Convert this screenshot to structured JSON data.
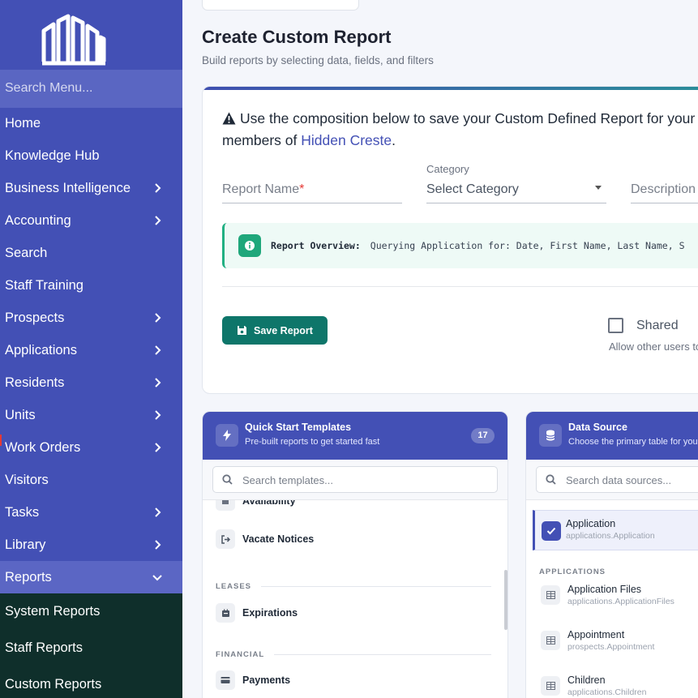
{
  "sidebar": {
    "search_placeholder": "Search Menu...",
    "items": [
      {
        "label": "Home",
        "chevron": false
      },
      {
        "label": "Knowledge Hub",
        "chevron": false
      },
      {
        "label": "Business Intelligence",
        "chevron": true
      },
      {
        "label": "Accounting",
        "chevron": true
      },
      {
        "label": "Search",
        "chevron": false
      },
      {
        "label": "Staff Training",
        "chevron": false
      },
      {
        "label": "Prospects",
        "chevron": true
      },
      {
        "label": "Applications",
        "chevron": true
      },
      {
        "label": "Residents",
        "chevron": true
      },
      {
        "label": "Units",
        "chevron": true
      },
      {
        "label": "Work Orders",
        "chevron": true
      },
      {
        "label": "Visitors",
        "chevron": false
      },
      {
        "label": "Tasks",
        "chevron": true
      },
      {
        "label": "Library",
        "chevron": true
      },
      {
        "label": "Reports",
        "chevron": true,
        "expanded": true
      }
    ],
    "sub_items": [
      "System Reports",
      "Staff Reports",
      "Custom Reports"
    ]
  },
  "header": {
    "title": "Create Custom Report",
    "subtitle": "Build reports by selecting data, fields, and filters"
  },
  "form": {
    "notice_text": "Use the composition below to save your Custom Defined Report for your",
    "notice_text2": "members of",
    "community": "Hidden Creste",
    "notice_end": ".",
    "report_name_label": "Report Name",
    "required_mark": "*",
    "category_label": "Category",
    "category_value": "Select Category",
    "description_label": "Description",
    "overview_label": "Report Overview:",
    "overview_text": "Querying Application for: Date, First Name, Last Name, S",
    "save_label": "Save Report",
    "shared_label": "Shared",
    "shared_help": "Allow other users to"
  },
  "templates": {
    "title": "Quick Start Templates",
    "subtitle": "Pre-built reports to get started fast",
    "count": "17",
    "search_placeholder": "Search templates...",
    "items": {
      "availability": "Availability",
      "vacate": "Vacate Notices",
      "leases_section": "LEASES",
      "expirations": "Expirations",
      "financial_section": "FINANCIAL",
      "payments": "Payments"
    }
  },
  "data_source": {
    "title": "Data Source",
    "subtitle": "Choose the primary table for your",
    "search_placeholder": "Search data sources...",
    "selected": {
      "name": "Application",
      "path": "applications.Application"
    },
    "section": "APPLICATIONS",
    "items": [
      {
        "name": "Application Files",
        "path": "applications.ApplicationFiles"
      },
      {
        "name": "Appointment",
        "path": "prospects.Appointment"
      },
      {
        "name": "Children",
        "path": "applications.Children"
      }
    ]
  },
  "colors": {
    "sidebar": "#4350b5",
    "accent_green": "#0e766a",
    "submenu_bg": "#0f2f2b"
  }
}
